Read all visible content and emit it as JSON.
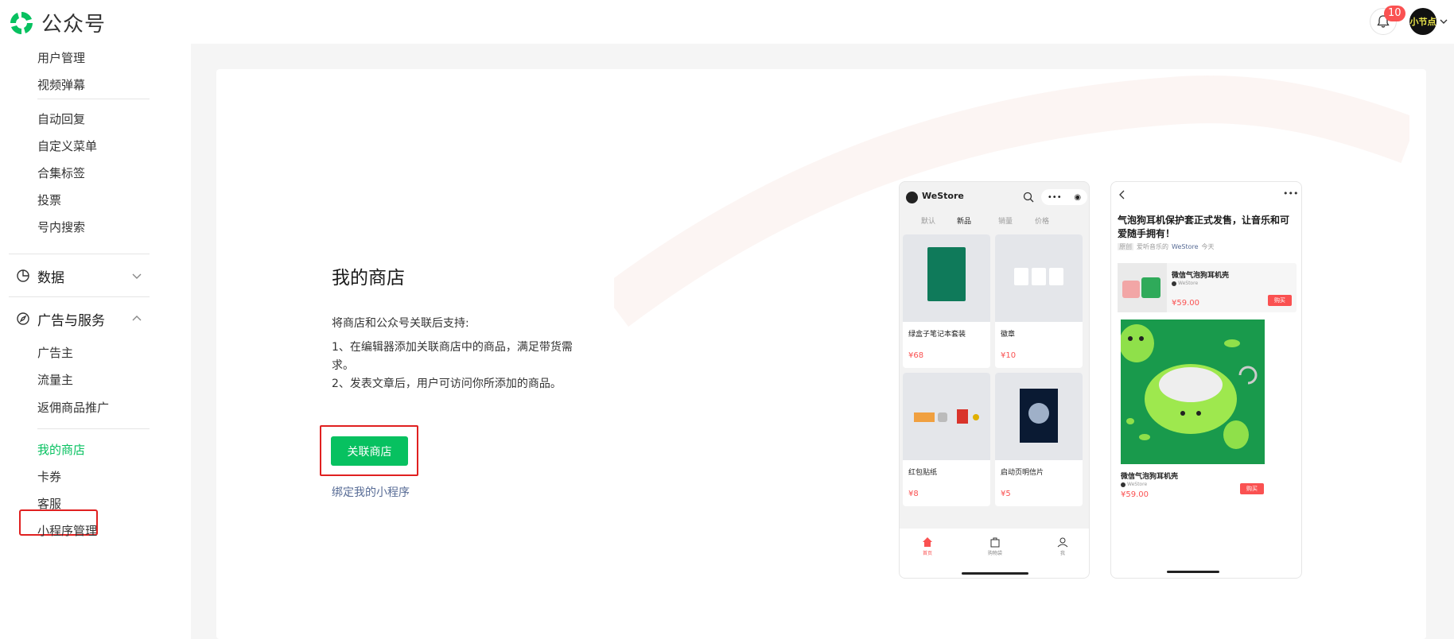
{
  "header": {
    "app_title": "公众号",
    "notification_count": "10",
    "avatar_text": "小节点"
  },
  "sidebar": {
    "top_items": [
      "用户管理",
      "视频弹幕"
    ],
    "function_items": [
      "自动回复",
      "自定义菜单",
      "合集标签",
      "投票",
      "号内搜索"
    ],
    "groups": [
      {
        "label": "数据",
        "expanded": false
      },
      {
        "label": "广告与服务",
        "expanded": true
      }
    ],
    "ads_items": [
      "广告主",
      "流量主",
      "返佣商品推广"
    ],
    "service_items": [
      "我的商店",
      "卡券",
      "客服",
      "小程序管理"
    ],
    "active_item": "我的商店"
  },
  "main": {
    "title": "我的商店",
    "description": "将商店和公众号关联后支持:",
    "support_lines": [
      "1、在编辑器添加关联商店中的商品，满足带货需",
      "求。",
      "2、发表文章后，用户可访问你所添加的商品。"
    ],
    "link_button": "关联商店",
    "mini_program_link": "绑定我的小程序"
  },
  "preview_store": {
    "store_name": "WeStore",
    "tabs": [
      "默认",
      "新品",
      "销量",
      "价格"
    ],
    "products": [
      {
        "name": "绿盒子笔记本套装",
        "price": "¥68"
      },
      {
        "name": "徽章",
        "price": "¥10"
      },
      {
        "name": "红包贴纸",
        "price": "¥8"
      },
      {
        "name": "启动页明信片",
        "price": "¥5"
      }
    ],
    "bottom_nav": [
      "首页",
      "购物袋",
      "我"
    ]
  },
  "preview_article": {
    "title": "气泡狗耳机保护套正式发售，让音乐和可爱随手拥有！",
    "meta_original": "原创",
    "meta_author": "爱听音乐的",
    "meta_account": "WeStore",
    "meta_time": "今天",
    "product_name": "微信气泡狗耳机壳",
    "product_store": "WeStore",
    "product_price": "¥59.00",
    "buy_label": "购买",
    "big_product_name": "微信气泡狗耳机壳",
    "big_product_store": "WeStore",
    "big_product_price": "¥59.00"
  },
  "colors": {
    "brand_green": "#07c160",
    "highlight_red": "#e02020",
    "price_red": "#fa5151",
    "link_blue": "#576b95"
  }
}
